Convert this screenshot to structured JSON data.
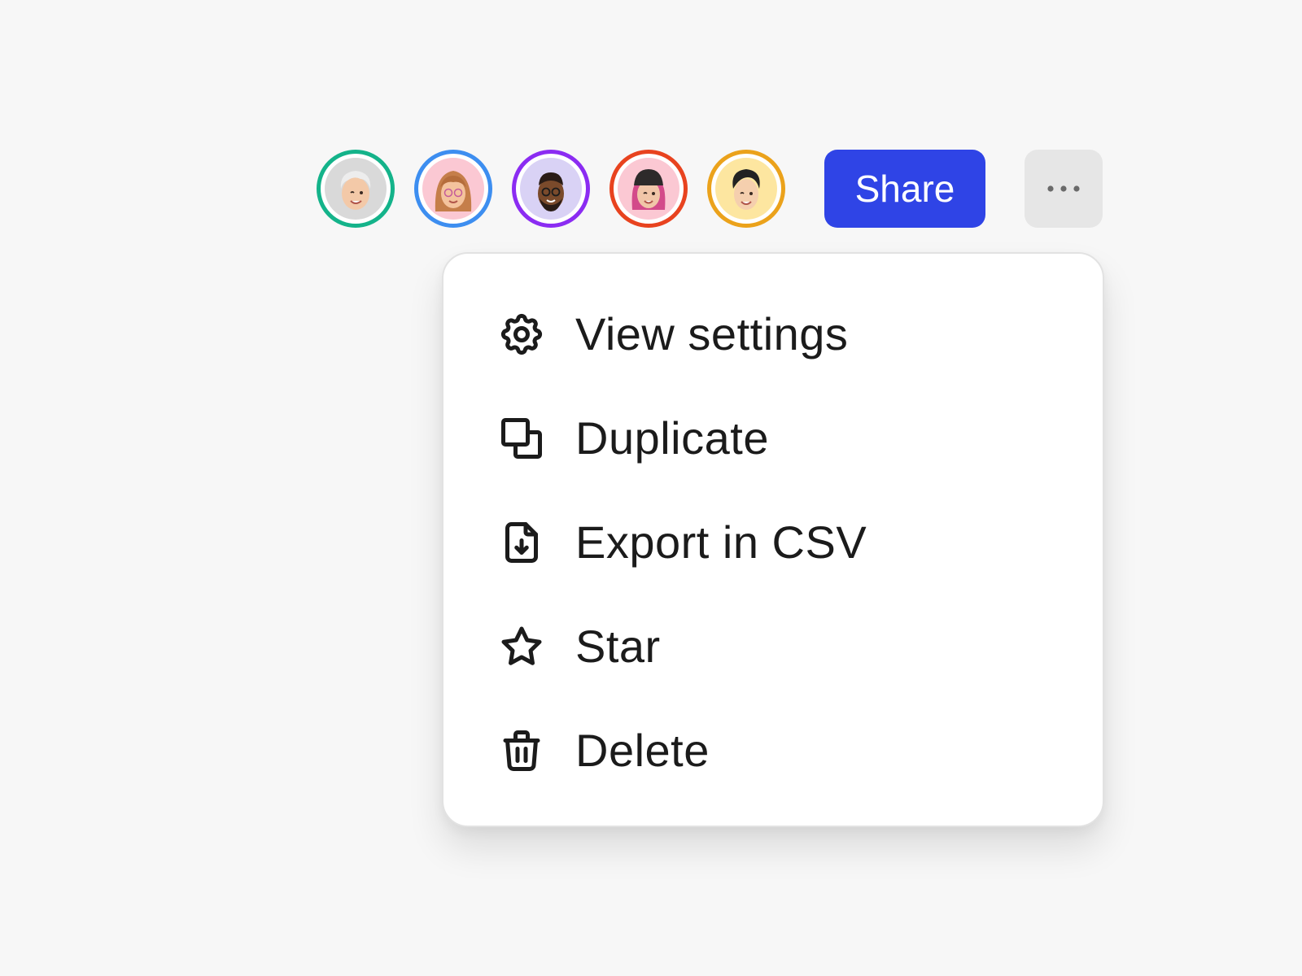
{
  "collaborators": [
    {
      "name": "avatar-1",
      "ring_color": "#14b38a",
      "bg_color": "#d9d9d9",
      "hair_color": "#e9e9e9",
      "skin_color": "#f3c9a8",
      "expression": "wink"
    },
    {
      "name": "avatar-2",
      "ring_color": "#3d8ef0",
      "bg_color": "#fbc8d3",
      "hair_color": "#c57e4a",
      "skin_color": "#f4c39d",
      "expression": "glasses"
    },
    {
      "name": "avatar-3",
      "ring_color": "#8b2cf2",
      "bg_color": "#d9d2f5",
      "hair_color": "#2a1c16",
      "skin_color": "#7a4a2b",
      "expression": "glasses"
    },
    {
      "name": "avatar-4",
      "ring_color": "#e8431f",
      "bg_color": "#fbc8d3",
      "hair_color": "#2d2a2a",
      "skin_color": "#f1c6a8",
      "expression": "wink"
    },
    {
      "name": "avatar-5",
      "ring_color": "#eba21b",
      "bg_color": "#fde6a0",
      "hair_color": "#222222",
      "skin_color": "#f5cfae",
      "expression": "wink"
    }
  ],
  "toolbar": {
    "share_label": "Share",
    "share_color": "#2f44e6",
    "more_icon": "more-horizontal-icon"
  },
  "menu": {
    "items": [
      {
        "label": "View settings",
        "icon": "gear-icon"
      },
      {
        "label": "Duplicate",
        "icon": "duplicate-icon"
      },
      {
        "label": "Export in CSV",
        "icon": "file-download-icon"
      },
      {
        "label": "Star",
        "icon": "star-icon"
      },
      {
        "label": "Delete",
        "icon": "trash-icon"
      }
    ]
  }
}
